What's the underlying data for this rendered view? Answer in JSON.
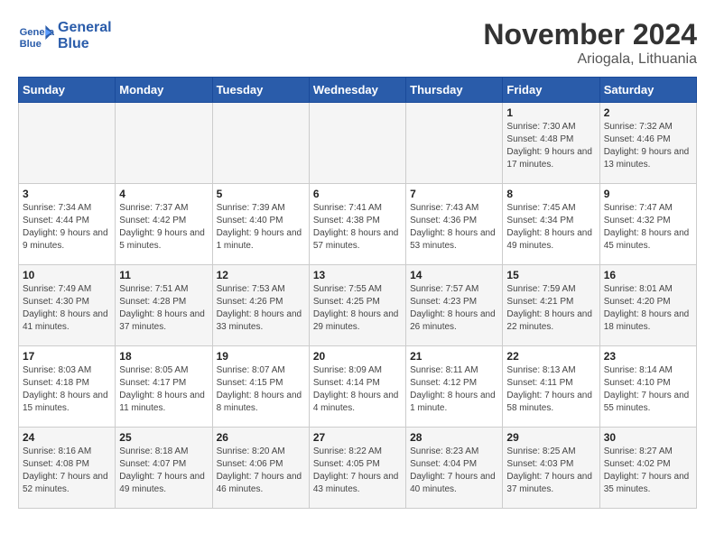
{
  "logo": {
    "text_general": "General",
    "text_blue": "Blue"
  },
  "title": {
    "month_year": "November 2024",
    "location": "Ariogala, Lithuania"
  },
  "days_of_week": [
    "Sunday",
    "Monday",
    "Tuesday",
    "Wednesday",
    "Thursday",
    "Friday",
    "Saturday"
  ],
  "weeks": [
    [
      {
        "day": "",
        "content": ""
      },
      {
        "day": "",
        "content": ""
      },
      {
        "day": "",
        "content": ""
      },
      {
        "day": "",
        "content": ""
      },
      {
        "day": "",
        "content": ""
      },
      {
        "day": "1",
        "content": "Sunrise: 7:30 AM\nSunset: 4:48 PM\nDaylight: 9 hours and 17 minutes."
      },
      {
        "day": "2",
        "content": "Sunrise: 7:32 AM\nSunset: 4:46 PM\nDaylight: 9 hours and 13 minutes."
      }
    ],
    [
      {
        "day": "3",
        "content": "Sunrise: 7:34 AM\nSunset: 4:44 PM\nDaylight: 9 hours and 9 minutes."
      },
      {
        "day": "4",
        "content": "Sunrise: 7:37 AM\nSunset: 4:42 PM\nDaylight: 9 hours and 5 minutes."
      },
      {
        "day": "5",
        "content": "Sunrise: 7:39 AM\nSunset: 4:40 PM\nDaylight: 9 hours and 1 minute."
      },
      {
        "day": "6",
        "content": "Sunrise: 7:41 AM\nSunset: 4:38 PM\nDaylight: 8 hours and 57 minutes."
      },
      {
        "day": "7",
        "content": "Sunrise: 7:43 AM\nSunset: 4:36 PM\nDaylight: 8 hours and 53 minutes."
      },
      {
        "day": "8",
        "content": "Sunrise: 7:45 AM\nSunset: 4:34 PM\nDaylight: 8 hours and 49 minutes."
      },
      {
        "day": "9",
        "content": "Sunrise: 7:47 AM\nSunset: 4:32 PM\nDaylight: 8 hours and 45 minutes."
      }
    ],
    [
      {
        "day": "10",
        "content": "Sunrise: 7:49 AM\nSunset: 4:30 PM\nDaylight: 8 hours and 41 minutes."
      },
      {
        "day": "11",
        "content": "Sunrise: 7:51 AM\nSunset: 4:28 PM\nDaylight: 8 hours and 37 minutes."
      },
      {
        "day": "12",
        "content": "Sunrise: 7:53 AM\nSunset: 4:26 PM\nDaylight: 8 hours and 33 minutes."
      },
      {
        "day": "13",
        "content": "Sunrise: 7:55 AM\nSunset: 4:25 PM\nDaylight: 8 hours and 29 minutes."
      },
      {
        "day": "14",
        "content": "Sunrise: 7:57 AM\nSunset: 4:23 PM\nDaylight: 8 hours and 26 minutes."
      },
      {
        "day": "15",
        "content": "Sunrise: 7:59 AM\nSunset: 4:21 PM\nDaylight: 8 hours and 22 minutes."
      },
      {
        "day": "16",
        "content": "Sunrise: 8:01 AM\nSunset: 4:20 PM\nDaylight: 8 hours and 18 minutes."
      }
    ],
    [
      {
        "day": "17",
        "content": "Sunrise: 8:03 AM\nSunset: 4:18 PM\nDaylight: 8 hours and 15 minutes."
      },
      {
        "day": "18",
        "content": "Sunrise: 8:05 AM\nSunset: 4:17 PM\nDaylight: 8 hours and 11 minutes."
      },
      {
        "day": "19",
        "content": "Sunrise: 8:07 AM\nSunset: 4:15 PM\nDaylight: 8 hours and 8 minutes."
      },
      {
        "day": "20",
        "content": "Sunrise: 8:09 AM\nSunset: 4:14 PM\nDaylight: 8 hours and 4 minutes."
      },
      {
        "day": "21",
        "content": "Sunrise: 8:11 AM\nSunset: 4:12 PM\nDaylight: 8 hours and 1 minute."
      },
      {
        "day": "22",
        "content": "Sunrise: 8:13 AM\nSunset: 4:11 PM\nDaylight: 7 hours and 58 minutes."
      },
      {
        "day": "23",
        "content": "Sunrise: 8:14 AM\nSunset: 4:10 PM\nDaylight: 7 hours and 55 minutes."
      }
    ],
    [
      {
        "day": "24",
        "content": "Sunrise: 8:16 AM\nSunset: 4:08 PM\nDaylight: 7 hours and 52 minutes."
      },
      {
        "day": "25",
        "content": "Sunrise: 8:18 AM\nSunset: 4:07 PM\nDaylight: 7 hours and 49 minutes."
      },
      {
        "day": "26",
        "content": "Sunrise: 8:20 AM\nSunset: 4:06 PM\nDaylight: 7 hours and 46 minutes."
      },
      {
        "day": "27",
        "content": "Sunrise: 8:22 AM\nSunset: 4:05 PM\nDaylight: 7 hours and 43 minutes."
      },
      {
        "day": "28",
        "content": "Sunrise: 8:23 AM\nSunset: 4:04 PM\nDaylight: 7 hours and 40 minutes."
      },
      {
        "day": "29",
        "content": "Sunrise: 8:25 AM\nSunset: 4:03 PM\nDaylight: 7 hours and 37 minutes."
      },
      {
        "day": "30",
        "content": "Sunrise: 8:27 AM\nSunset: 4:02 PM\nDaylight: 7 hours and 35 minutes."
      }
    ]
  ]
}
